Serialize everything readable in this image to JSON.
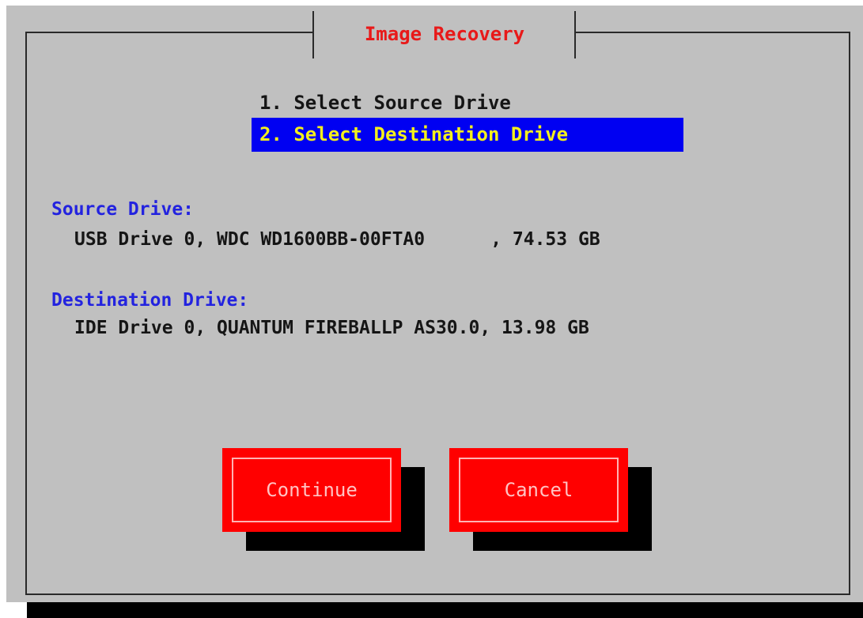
{
  "dialog": {
    "title": "Image Recovery"
  },
  "menu": {
    "items": [
      {
        "label": "1. Select Source Drive",
        "selected": false
      },
      {
        "label": "2. Select Destination Drive",
        "selected": true
      }
    ]
  },
  "source": {
    "label": "Source Drive:",
    "value": "USB Drive 0, WDC WD1600BB-00FTA0      , 74.53 GB"
  },
  "destination": {
    "label": "Destination Drive:",
    "value": "IDE Drive 0, QUANTUM FIREBALLP AS30.0, 13.98 GB"
  },
  "buttons": {
    "continue_label": "Continue",
    "cancel_label": "Cancel"
  },
  "colors": {
    "background": "#c0c0c0",
    "title": "#e81919",
    "selection_background": "#0000f2",
    "selection_text": "#f3ef1d",
    "section_label": "#2323df",
    "button": "#ff0000",
    "button_text": "#ffc3c3"
  }
}
